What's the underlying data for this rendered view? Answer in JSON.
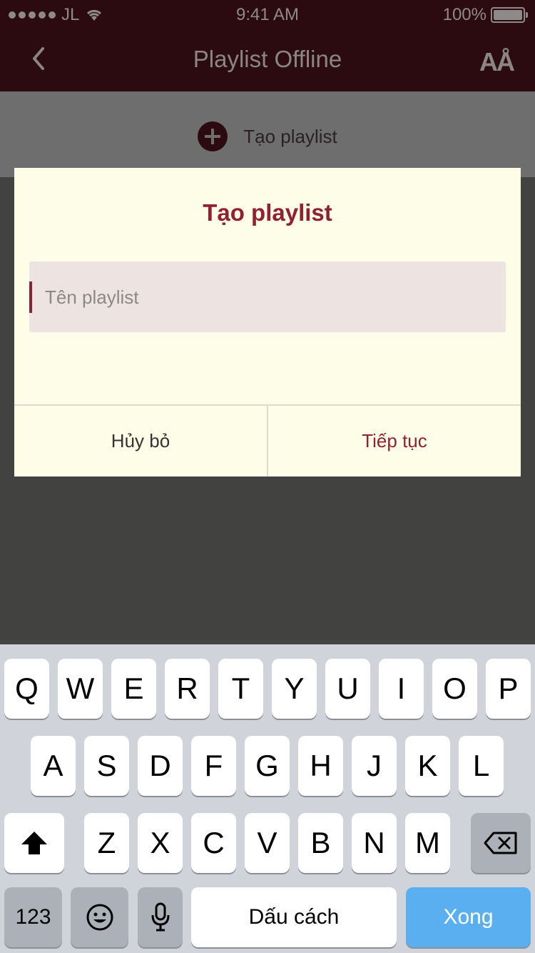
{
  "status_bar": {
    "carrier": "JL",
    "time": "9:41 AM",
    "battery": "100%"
  },
  "nav": {
    "title": "Playlist Offline",
    "font_button": "AÅ"
  },
  "page": {
    "create_label": "Tạo playlist"
  },
  "dialog": {
    "title": "Tạo playlist",
    "input_value": "",
    "input_placeholder": "Tên playlist",
    "cancel_label": "Hủy bỏ",
    "continue_label": "Tiếp tục"
  },
  "keyboard": {
    "row1": [
      "Q",
      "W",
      "E",
      "R",
      "T",
      "Y",
      "U",
      "I",
      "O",
      "P"
    ],
    "row2": [
      "A",
      "S",
      "D",
      "F",
      "G",
      "H",
      "J",
      "K",
      "L"
    ],
    "row3": [
      "Z",
      "X",
      "C",
      "V",
      "B",
      "N",
      "M"
    ],
    "numbers_label": "123",
    "space_label": "Dấu cách",
    "done_label": "Xong"
  },
  "colors": {
    "accent": "#8f2035",
    "dialog_bg": "#fefee8",
    "done_key": "#5aaff0"
  }
}
